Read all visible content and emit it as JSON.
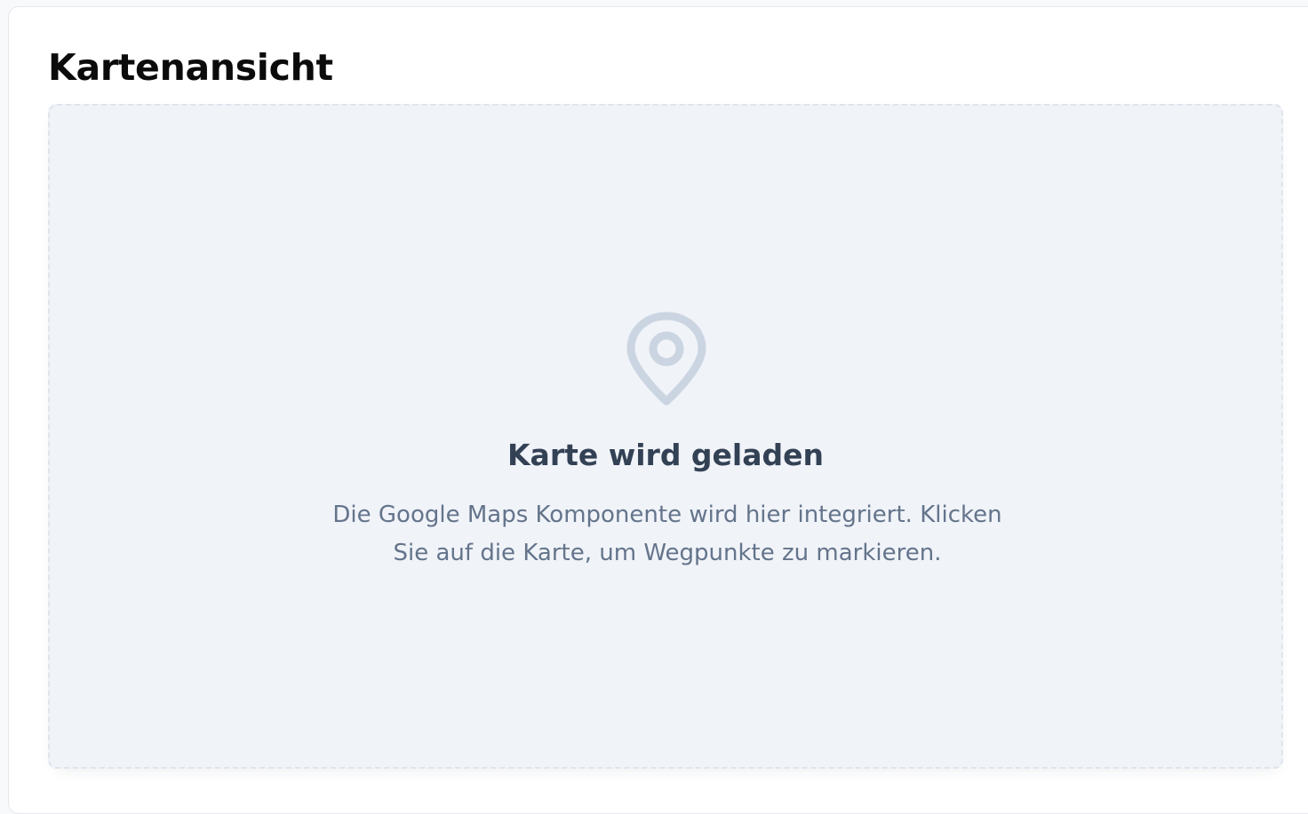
{
  "card": {
    "title": "Kartenansicht"
  },
  "map": {
    "icon": "map-pin-icon",
    "status_title": "Karte wird geladen",
    "status_description": "Die Google Maps Komponente wird hier integriert. Klicken Sie auf die Karte, um Wegpunkte zu markieren."
  },
  "colors": {
    "map_background": "#f0f3f8",
    "icon_color": "#cbd5e1",
    "title_color": "#334155",
    "description_color": "#64748b"
  }
}
